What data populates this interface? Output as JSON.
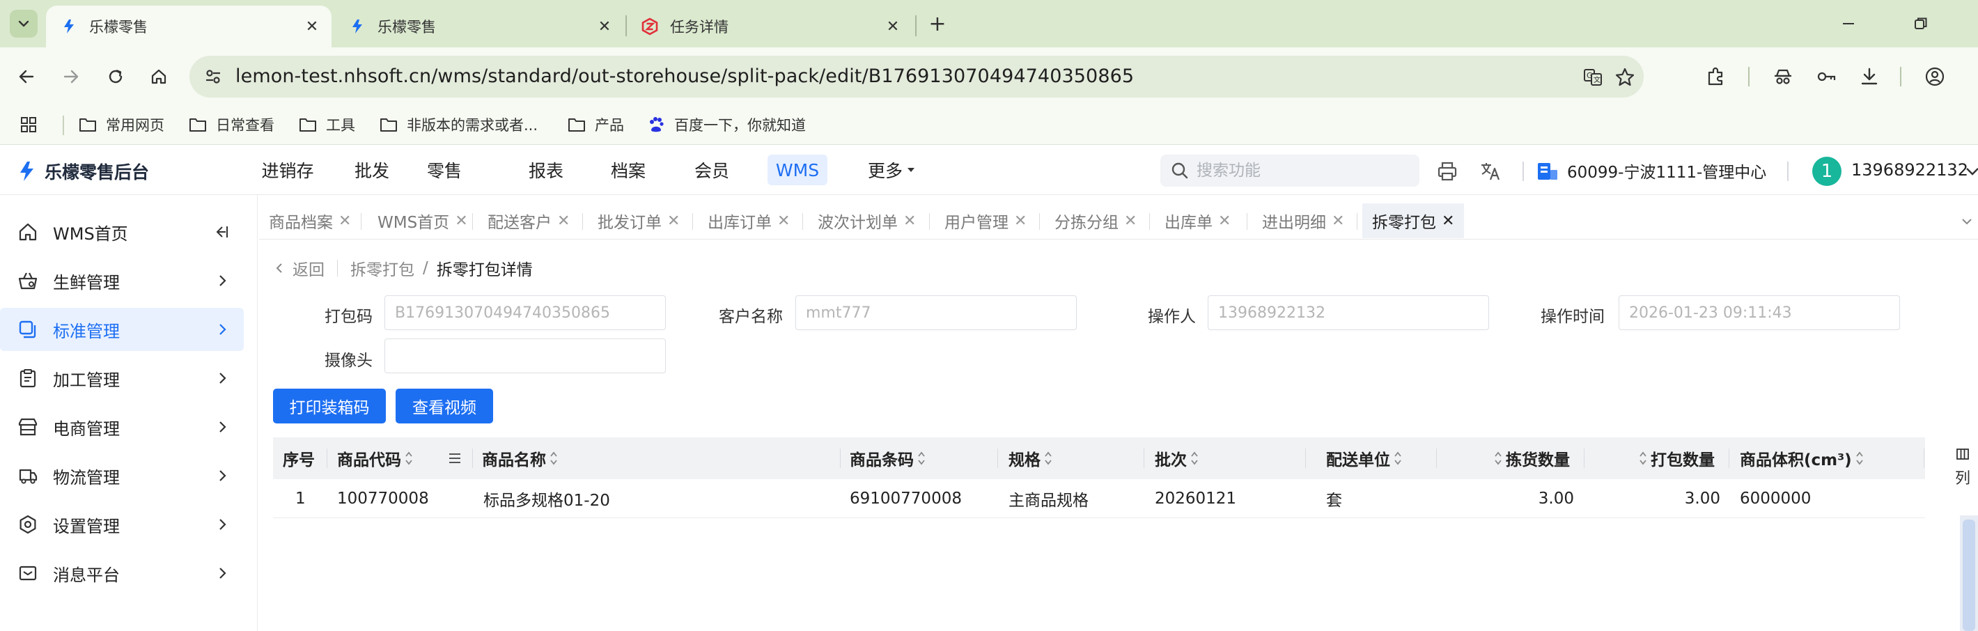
{
  "browser": {
    "tabs": [
      {
        "title": "乐檬零售",
        "active": true
      },
      {
        "title": "乐檬零售",
        "active": false
      },
      {
        "title": "任务详情",
        "active": false
      }
    ],
    "url": "lemon-test.nhsoft.cn/wms/standard/out-storehouse/split-pack/edit/B176913070494740350865",
    "bookmarks": [
      "常用网页",
      "日常查看",
      "工具",
      "非版本的需求或者...",
      "产品",
      "百度一下，你就知道"
    ]
  },
  "app": {
    "logo_text": "乐檬零售后台",
    "nav": [
      "进销存",
      "批发",
      "零售",
      "报表",
      "档案",
      "会员",
      "WMS",
      "更多"
    ],
    "active_nav": "WMS",
    "search_placeholder": "搜索功能",
    "store": "60099-宁波1111-管理中心",
    "avatar_initial": "1",
    "username": "13968922132",
    "accent": "#1d6ff2"
  },
  "sidebar": {
    "items": [
      {
        "label": "WMS首页",
        "icon": "home-icon"
      },
      {
        "label": "生鲜管理",
        "icon": "basket-icon"
      },
      {
        "label": "标准管理",
        "icon": "copy-icon",
        "active": true
      },
      {
        "label": "加工管理",
        "icon": "clipboard-icon"
      },
      {
        "label": "电商管理",
        "icon": "shop-icon"
      },
      {
        "label": "物流管理",
        "icon": "truck-icon"
      },
      {
        "label": "设置管理",
        "icon": "gear-icon"
      },
      {
        "label": "消息平台",
        "icon": "message-icon"
      }
    ]
  },
  "page_tabs": [
    "商品档案",
    "WMS首页",
    "配送客户",
    "批发订单",
    "出库订单",
    "波次计划单",
    "用户管理",
    "分拣分组",
    "出库单",
    "进出明细",
    "拆零打包"
  ],
  "active_page_tab": "拆零打包",
  "breadcrumb": {
    "back": "返回",
    "parent": "拆零打包",
    "current": "拆零打包详情"
  },
  "form": {
    "pack_code_label": "打包码",
    "pack_code_value": "B176913070494740350865",
    "customer_label": "客户名称",
    "customer_value": "mmt777",
    "operator_label": "操作人",
    "operator_value": "13968922132",
    "op_time_label": "操作时间",
    "op_time_value": "2026-01-23 09:11:43",
    "camera_label": "摄像头",
    "camera_value": ""
  },
  "buttons": {
    "print": "打印装箱码",
    "video": "查看视频"
  },
  "table": {
    "headers": [
      "序号",
      "商品代码",
      "商品名称",
      "商品条码",
      "规格",
      "批次",
      "配送单位",
      "拣货数量",
      "打包数量",
      "商品体积(cm³)"
    ],
    "rows": [
      [
        "1",
        "100770008",
        "标品多规格01-20",
        "69100770008",
        "主商品规格",
        "20260121",
        "套",
        "3.00",
        "3.00",
        "6000000"
      ]
    ],
    "column_config": "列"
  }
}
